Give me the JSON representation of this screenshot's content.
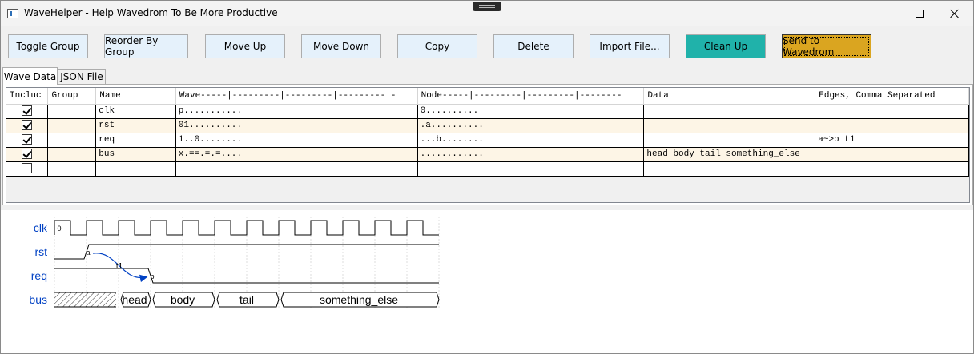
{
  "window": {
    "title": "WaveHelper - Help Wavedrom To Be More Productive"
  },
  "toolbar": {
    "buttons": [
      {
        "label": "Toggle Group"
      },
      {
        "label": "Reorder By Group"
      },
      {
        "label": "Move Up"
      },
      {
        "label": "Move Down"
      },
      {
        "label": "Copy"
      },
      {
        "label": "Delete"
      },
      {
        "label": "Import File..."
      },
      {
        "label": "Clean Up",
        "color": "#20b2aa"
      },
      {
        "label": "Send to Wavedrom",
        "color": "#daa520"
      }
    ]
  },
  "tabs": [
    {
      "label": "Wave Data",
      "active": true
    },
    {
      "label": "JSON File",
      "active": false
    }
  ],
  "grid": {
    "columns": [
      "Incluc",
      "Group",
      "Name",
      "Wave-----|---------|---------|---------|-",
      "Node-----|---------|---------|--------",
      "Data",
      "Edges, Comma Separated"
    ],
    "rows": [
      {
        "include": true,
        "group": "",
        "name": "clk",
        "wave": "p...........",
        "node": "0..........",
        "data": "",
        "edges": ""
      },
      {
        "include": true,
        "group": "",
        "name": "rst",
        "wave": "01..........",
        "node": ".a..........",
        "data": "",
        "edges": ""
      },
      {
        "include": true,
        "group": "",
        "name": "req",
        "wave": "1..0........",
        "node": "...b........",
        "data": "",
        "edges": "a~>b t1"
      },
      {
        "include": true,
        "group": "",
        "name": "bus",
        "wave": "x.==.=.=....",
        "node": "............",
        "data": "head body tail something_else",
        "edges": ""
      },
      {
        "include": false,
        "group": "",
        "name": "",
        "wave": "",
        "node": "",
        "data": "",
        "edges": ""
      }
    ],
    "alt_row_color": "#fdf5e6"
  },
  "waveform": {
    "signals": [
      {
        "name": "clk",
        "wave": "p..........."
      },
      {
        "name": "rst",
        "wave": "01.........."
      },
      {
        "name": "req",
        "wave": "1..0........"
      },
      {
        "name": "bus",
        "wave": "x.==.=.=....",
        "data": [
          "head",
          "body",
          "tail",
          "something_else"
        ]
      }
    ],
    "node_labels": [
      "0",
      "a",
      "b"
    ],
    "edge_label": "t1",
    "label_color": "#0041c4",
    "edge_color": "#0041c4"
  }
}
